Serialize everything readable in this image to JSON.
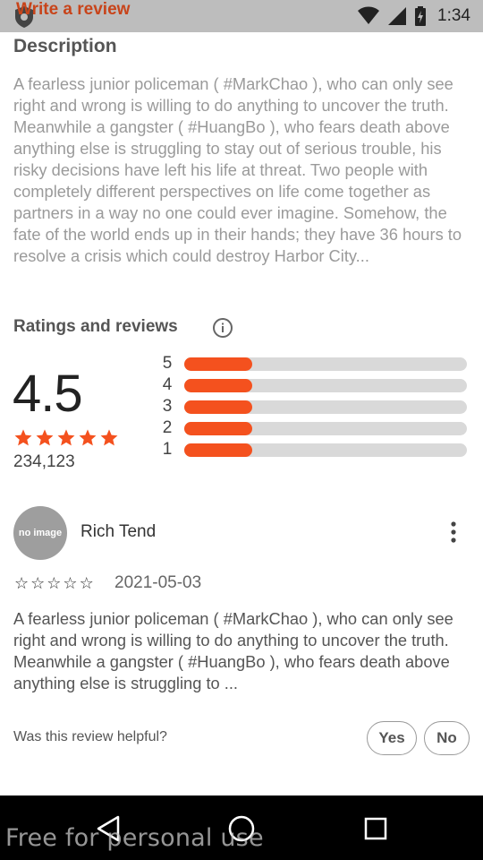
{
  "status_bar": {
    "app_title": "Write a review",
    "time": "1:34",
    "background": "#bdbdbd"
  },
  "description": {
    "title": "Description",
    "text": "A fearless junior policeman ( #MarkChao ), who can only see right and wrong is willing to do anything to uncover the truth. Meanwhile a gangster ( #HuangBo ), who fears death above anything else is struggling to stay out of serious trouble, his risky decisions have left his life at threat. Two people with completely different perspectives on life come together as partners in a way no one could ever imagine. Somehow, the fate of the world ends up in their hands; they have 36 hours to resolve a crisis which could destroy Harbor City..."
  },
  "ratings": {
    "title": "Ratings and reviews",
    "info_icon": "info-icon",
    "average": "4.5",
    "average_stars": 5,
    "total_count": "234,123",
    "accent": "#f4511e",
    "distribution": [
      {
        "label": "5",
        "fraction": 0.24
      },
      {
        "label": "4",
        "fraction": 0.24
      },
      {
        "label": "3",
        "fraction": 0.24
      },
      {
        "label": "2",
        "fraction": 0.24
      },
      {
        "label": "1",
        "fraction": 0.24
      }
    ]
  },
  "review": {
    "avatar_text": "no image",
    "author": "Rich Tend",
    "stars_filled": 0,
    "stars_total": 5,
    "date": "2021-05-03",
    "text": "A fearless junior policeman ( #MarkChao ), who can only see right and wrong is willing to do anything to uncover the truth. Meanwhile a gangster ( #HuangBo ), who fears death above anything else is struggling to ...",
    "more_icon": "more-vert-icon",
    "helpful_question": "Was this review helpful?",
    "yes_label": "Yes",
    "no_label": "No"
  },
  "nav_bar": {
    "back_icon": "back-triangle-icon",
    "home_icon": "home-circle-icon",
    "recent_icon": "recent-square-icon"
  },
  "watermark": "Free for personal use"
}
